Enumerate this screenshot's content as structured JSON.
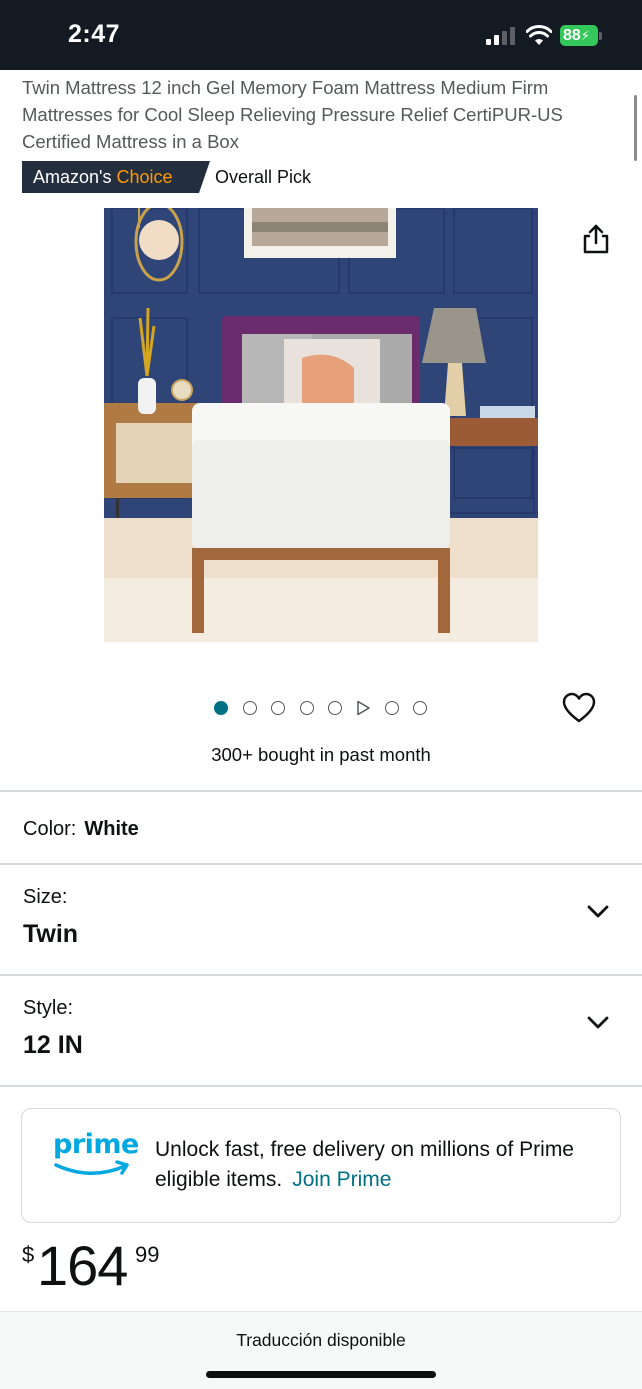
{
  "status_bar": {
    "time": "2:47",
    "battery": "88",
    "background": "#131a22"
  },
  "product": {
    "title": "Twin Mattress 12 inch Gel Memory Foam Mattress Medium Firm Mattresses for Cool Sleep Relieving Pressure Relief CertiPUR-US Certified Mattress in a Box",
    "badge_prefix": "Amazon's",
    "badge_accent": "Choice",
    "badge_suffix": "Overall Pick",
    "image_icon": "mattress-product-photo",
    "carousel": {
      "total_images": 7,
      "active_index": 0,
      "video_index": 5
    },
    "bought": "300+ bought in past month"
  },
  "variations": {
    "color": {
      "label": "Color:",
      "value": "White"
    },
    "size": {
      "label": "Size:",
      "value": "Twin"
    },
    "style": {
      "label": "Style:",
      "value": "12 IN"
    }
  },
  "prime": {
    "logo": "prime",
    "message": "Unlock fast, free delivery on millions of Prime eligible items.",
    "link": "Join Prime",
    "brand_color": "#00a8e1",
    "link_color": "#007185"
  },
  "price": {
    "symbol": "$",
    "whole": "164",
    "fraction": "99"
  },
  "footer": {
    "translate": "Traducción disponible"
  },
  "colors": {
    "badge_bg": "#232f3e",
    "badge_accent": "#ff9900",
    "active_dot": "#007185"
  }
}
